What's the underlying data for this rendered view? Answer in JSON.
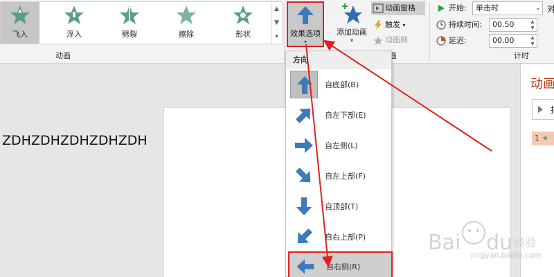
{
  "ribbon": {
    "animations": [
      {
        "label": "飞入",
        "selected": true
      },
      {
        "label": "浮入",
        "selected": false
      },
      {
        "label": "劈裂",
        "selected": false
      },
      {
        "label": "擦除",
        "selected": false
      },
      {
        "label": "形状",
        "selected": false
      }
    ],
    "group_animation_label": "动画",
    "effect_options_label": "效果选项",
    "add_animation_label": "添加动画",
    "animation_pane_label": "动画窗格",
    "trigger_label": "触发",
    "animation_painter_label": "动画刷",
    "group_advanced_label": "画",
    "timing": {
      "start_label": "开始:",
      "start_value": "单击时",
      "duration_label": "持续时间:",
      "duration_value": "00.50",
      "delay_label": "延迟:",
      "delay_value": "00.00",
      "group_label": "计时",
      "right_edge_label": "对"
    }
  },
  "slide": {
    "text": "ZDHZDHZDHZDHZDH"
  },
  "pane": {
    "title": "动画",
    "play_label": "排",
    "entry_number": "1"
  },
  "dropdown": {
    "header": "方向",
    "items": [
      {
        "label": "自底部(B)",
        "icon": "arrow-up-icon",
        "selected": true
      },
      {
        "label": "自左下部(E)",
        "icon": "arrow-up-right-icon",
        "selected": false
      },
      {
        "label": "自左侧(L)",
        "icon": "arrow-right-icon",
        "selected": false
      },
      {
        "label": "自左上部(F)",
        "icon": "arrow-down-right-icon",
        "selected": false
      },
      {
        "label": "自顶部(T)",
        "icon": "arrow-down-icon",
        "selected": false
      },
      {
        "label": "自右上部(P)",
        "icon": "arrow-down-left-icon",
        "selected": false
      },
      {
        "label": "自右侧(R)",
        "icon": "arrow-left-icon",
        "selected": false
      }
    ]
  },
  "watermark": {
    "text": "jingyan.baidu.com"
  },
  "colors": {
    "accent_red": "#e02020",
    "arrow_blue": "#3d7ab8",
    "star_green": "#5a9f7f",
    "pane_title": "#b83c1c"
  }
}
